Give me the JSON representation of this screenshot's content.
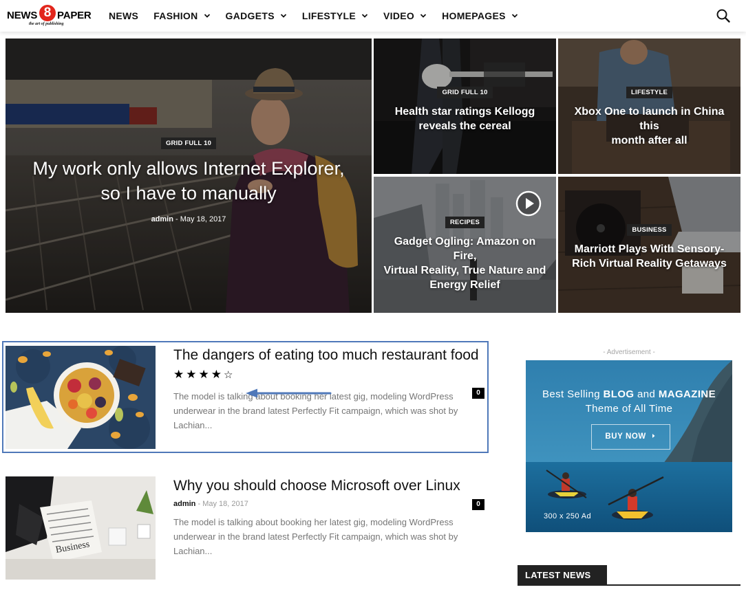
{
  "header": {
    "logo": {
      "word1": "NEWS",
      "digit": "8",
      "word2": "PAPER",
      "tagline": "the art of publishing"
    },
    "nav": [
      {
        "label": "NEWS",
        "dropdown": false
      },
      {
        "label": "FASHION",
        "dropdown": true
      },
      {
        "label": "GADGETS",
        "dropdown": true
      },
      {
        "label": "LIFESTYLE",
        "dropdown": true
      },
      {
        "label": "VIDEO",
        "dropdown": true
      },
      {
        "label": "HOMEPAGES",
        "dropdown": true
      }
    ],
    "search_icon": "search-icon"
  },
  "hero": {
    "main": {
      "category": "GRID FULL 10",
      "title_line1": "My work only allows Internet Explorer,",
      "title_line2": "so I have to manually",
      "author": "admin",
      "separator": "-",
      "date": "May 18, 2017"
    },
    "tiles": [
      {
        "category": "GRID FULL 10",
        "title_line1": "Health star ratings Kellogg",
        "title_line2": "reveals the cereal"
      },
      {
        "category": "LIFESTYLE",
        "title_line1": "Xbox One to launch in China this",
        "title_line2": "month after all"
      },
      {
        "category": "RECIPES",
        "title_line1": "Gadget Ogling: Amazon on Fire,",
        "title_line2": "Virtual Reality, True Nature and",
        "title_line3": "Energy Relief",
        "has_play_icon": true
      },
      {
        "category": "BUSINESS",
        "title_line1": "Marriott Plays With Sensory-",
        "title_line2": "Rich Virtual Reality Getaways"
      }
    ]
  },
  "articles": [
    {
      "title": "The dangers of eating too much restaurant food",
      "rating": {
        "filled": 4,
        "total": 5
      },
      "comments": "0",
      "excerpt": "The model is talking about booking her latest gig, modeling WordPress underwear in the brand latest Perfectly Fit campaign, which was shot by Lachian..."
    },
    {
      "title": "Why you should choose Microsoft over Linux",
      "author": "admin",
      "separator": "-",
      "date": "May 18, 2017",
      "comments": "0",
      "excerpt": "The model is talking about booking her latest gig, modeling WordPress underwear in the brand latest Perfectly Fit campaign, which was shot by Lachian..."
    }
  ],
  "sidebar": {
    "ad_label": "- Advertisement -",
    "ad": {
      "line1_prefix": "Best Selling ",
      "line1_bold1": "BLOG",
      "line1_mid": " and ",
      "line1_bold2": "MAGAZINE",
      "line2": "Theme of All Time",
      "button": "BUY NOW",
      "size": "300 x 250 Ad"
    },
    "latest_heading": "LATEST NEWS"
  },
  "colors": {
    "accent_box": "#4f78b9",
    "badge": "#222222",
    "logo_red": "#e2261c"
  }
}
